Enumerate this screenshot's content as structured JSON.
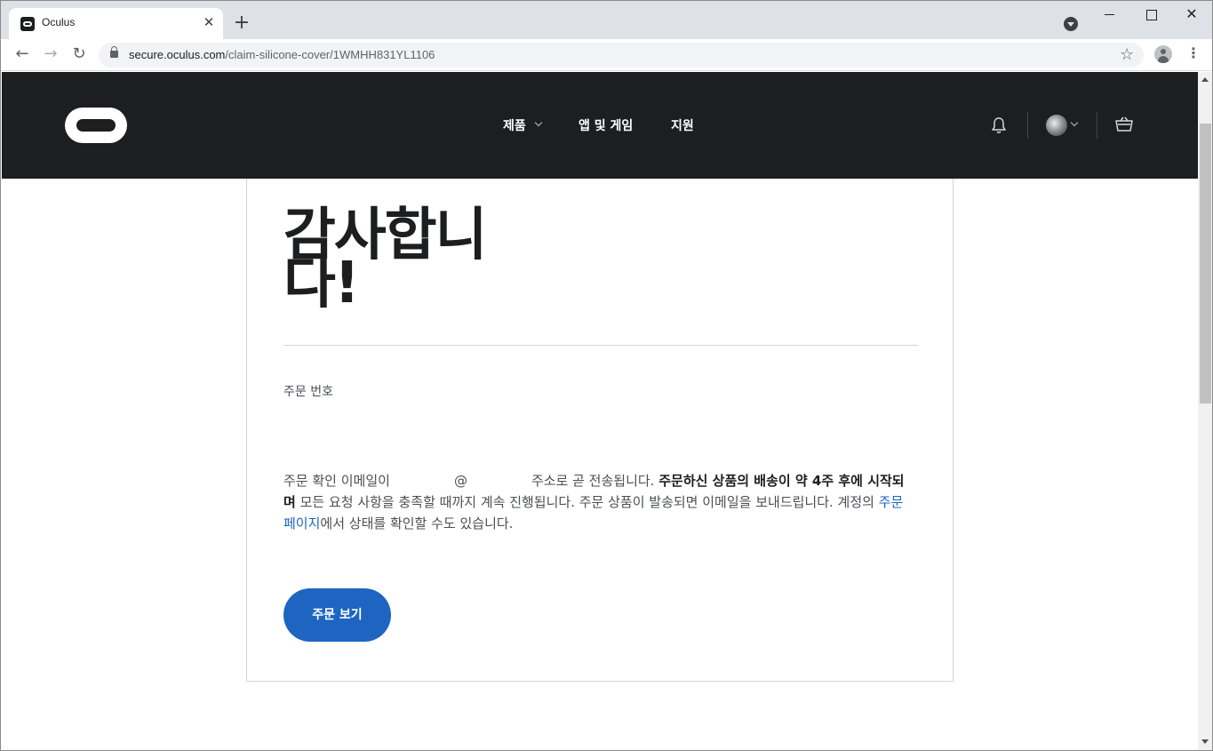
{
  "browser": {
    "tab_title": "Oculus",
    "tab_close": "✕",
    "new_tab": "+",
    "url_host": "secure.oculus.com",
    "url_path": "/claim-silicone-cover/1WMHH831YL1106",
    "win_close": "✕",
    "back": "←",
    "forward": "→",
    "reload": "↻",
    "star": "☆",
    "menu": "⋮"
  },
  "header": {
    "nav": {
      "products": "제품",
      "apps_games": "앱 및 게임",
      "support": "지원"
    }
  },
  "content": {
    "title": "감사합니다!",
    "order_number_label": "주문 번호",
    "message": {
      "part1": "주문 확인 이메일이",
      "at": "@",
      "part2": "주소로 곧 전송됩니다.",
      "bold": "주문하신 상품의 배송이 약 4주 후에 시작되며",
      "part3": "모든 요청 사항을 충족할 때까지 계속 진행됩니다. 주문 상품이 발송되면 이메일을 보내드립니다. 계정의",
      "link": "주문 페이지",
      "part4": "에서 상태를 확인할 수도 있습니다."
    },
    "view_order_button": "주문 보기"
  },
  "colors": {
    "header_bg": "#1c1e20",
    "accent": "#1d65c1",
    "link": "#1d65c1"
  }
}
